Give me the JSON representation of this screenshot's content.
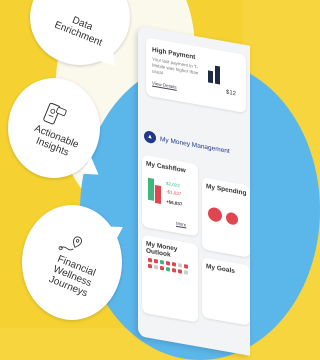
{
  "bubbles": {
    "top_label": "Data\nEnrichment",
    "middle_label": "Actionable\nInsights",
    "bottom_label": "Financial\nWellness\nJourneys"
  },
  "phone": {
    "high_payment": {
      "title": "High Payment",
      "body": "Your last payment to T-Mobile was higher than usual",
      "link": "View Details",
      "amount": "$12"
    },
    "header_title": "My Money Management",
    "cashflow": {
      "title": "My Cashflow",
      "income": "$2,022",
      "spending": "-$1,037",
      "net": "+$6,837",
      "more": "More"
    },
    "spending": {
      "title": "My Spending"
    },
    "outlook": {
      "title": "My Money Outlook"
    },
    "goals": {
      "title": "My Goals"
    }
  },
  "colors": {
    "yellow": "#f5d231",
    "blue": "#5bb6ea",
    "navy": "#1f3a8a",
    "red": "#e0464f",
    "green": "#3fb67b"
  }
}
